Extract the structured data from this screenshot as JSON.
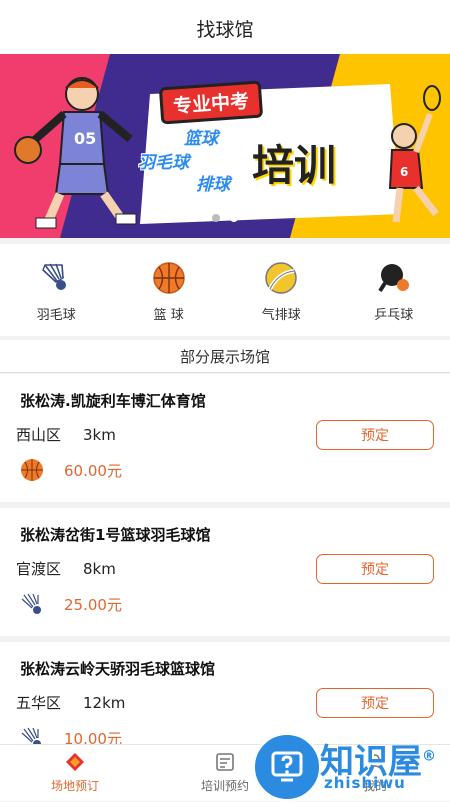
{
  "header": {
    "title": "找球馆"
  },
  "banner": {
    "tag": "专业中考",
    "sports": [
      "篮球",
      "羽毛球",
      "排球"
    ],
    "headline": "培训",
    "jersey": "05",
    "jersey2": "6",
    "slides": 2,
    "active_slide": 2
  },
  "categories": [
    {
      "label": "羽毛球",
      "icon": "shuttlecock-icon"
    },
    {
      "label": "篮 球",
      "icon": "basketball-icon"
    },
    {
      "label": "气排球",
      "icon": "volleyball-icon"
    },
    {
      "label": "乒乓球",
      "icon": "ping-pong-icon"
    }
  ],
  "section": {
    "title": "部分展示场馆"
  },
  "venues": [
    {
      "name": "张松涛.凯旋利车博汇体育馆",
      "district": "西山区",
      "distance": "3km",
      "price": "60.00元",
      "icon": "basketball-icon",
      "button": "预定"
    },
    {
      "name": "张松涛岔街1号篮球羽毛球馆",
      "district": "官渡区",
      "distance": "8km",
      "price": "25.00元",
      "icon": "shuttlecock-icon",
      "button": "预定"
    },
    {
      "name": "张松涛云岭天骄羽毛球篮球馆",
      "district": "五华区",
      "distance": "12km",
      "price": "10.00元",
      "icon": "shuttlecock-icon",
      "button": "预定"
    }
  ],
  "tabbar": [
    {
      "label": "场地预订",
      "icon": "venue-icon",
      "active": true
    },
    {
      "label": "培训预约",
      "icon": "training-icon",
      "active": false
    },
    {
      "label": "我的",
      "icon": "profile-icon",
      "active": false
    }
  ],
  "watermark": {
    "text": "知识屋",
    "sub": "zhishiwu",
    "mark": "®"
  },
  "colors": {
    "accent": "#e2672f",
    "banner_pink": "#f03d6e",
    "banner_purple": "#3f2c8e",
    "banner_yellow": "#ffc400",
    "watermark_blue": "#2a8be0"
  }
}
